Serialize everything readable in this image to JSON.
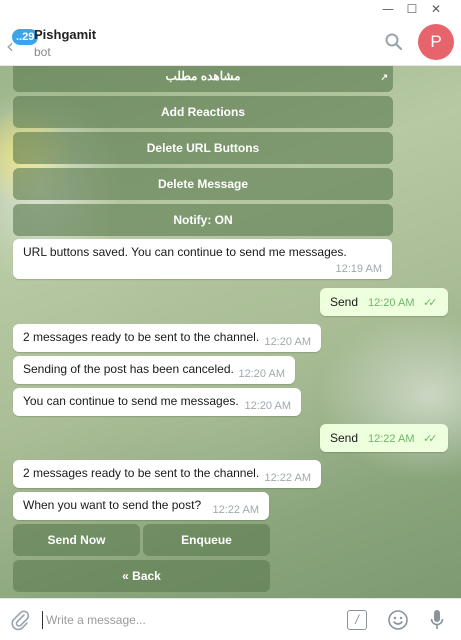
{
  "window": {
    "minimize": "—",
    "maximize": "☐",
    "close": "✕"
  },
  "header": {
    "back_arrow": "‹",
    "unread_count": "29",
    "title": "Pishgamit",
    "subtitle": "bot",
    "avatar_letter": "P"
  },
  "keyboard_top": [
    {
      "label": "مشاهده مطلب"
    },
    {
      "label": "Add Reactions"
    },
    {
      "label": "Delete URL Buttons"
    },
    {
      "label": "Delete Message"
    },
    {
      "label": "Notify: ON"
    }
  ],
  "messages": [
    {
      "text": "URL buttons saved. You can continue to send me messages.",
      "time": "12:19 AM"
    },
    {
      "text": "Send",
      "time": "12:20 AM"
    },
    {
      "text": "2 messages ready to be sent to the channel.",
      "time": "12:20 AM"
    },
    {
      "text": "Sending of the post has been canceled.",
      "time": "12:20 AM"
    },
    {
      "text": "You can continue to send me messages.",
      "time": "12:20 AM"
    },
    {
      "text": "Send",
      "time": "12:22 AM"
    },
    {
      "text": "2 messages ready to be sent to the channel.",
      "time": "12:22 AM"
    },
    {
      "text": "When you want to send the post?",
      "time": "12:22 AM"
    }
  ],
  "keyboard_bottom": {
    "send_now": "Send Now",
    "enqueue": "Enqueue",
    "back": "« Back"
  },
  "composer": {
    "placeholder": "Write a message...",
    "commands_glyph": "/"
  },
  "colors": {
    "accent": "#3ca5e8",
    "avatar": "#e8646c",
    "outgoing_bubble": "#eeffde",
    "ticks": "#6fb56a"
  },
  "icons": [
    "back-arrow-icon",
    "search-icon",
    "attach-icon",
    "commands-icon",
    "emoji-icon",
    "microphone-icon",
    "double-check-icon"
  ]
}
